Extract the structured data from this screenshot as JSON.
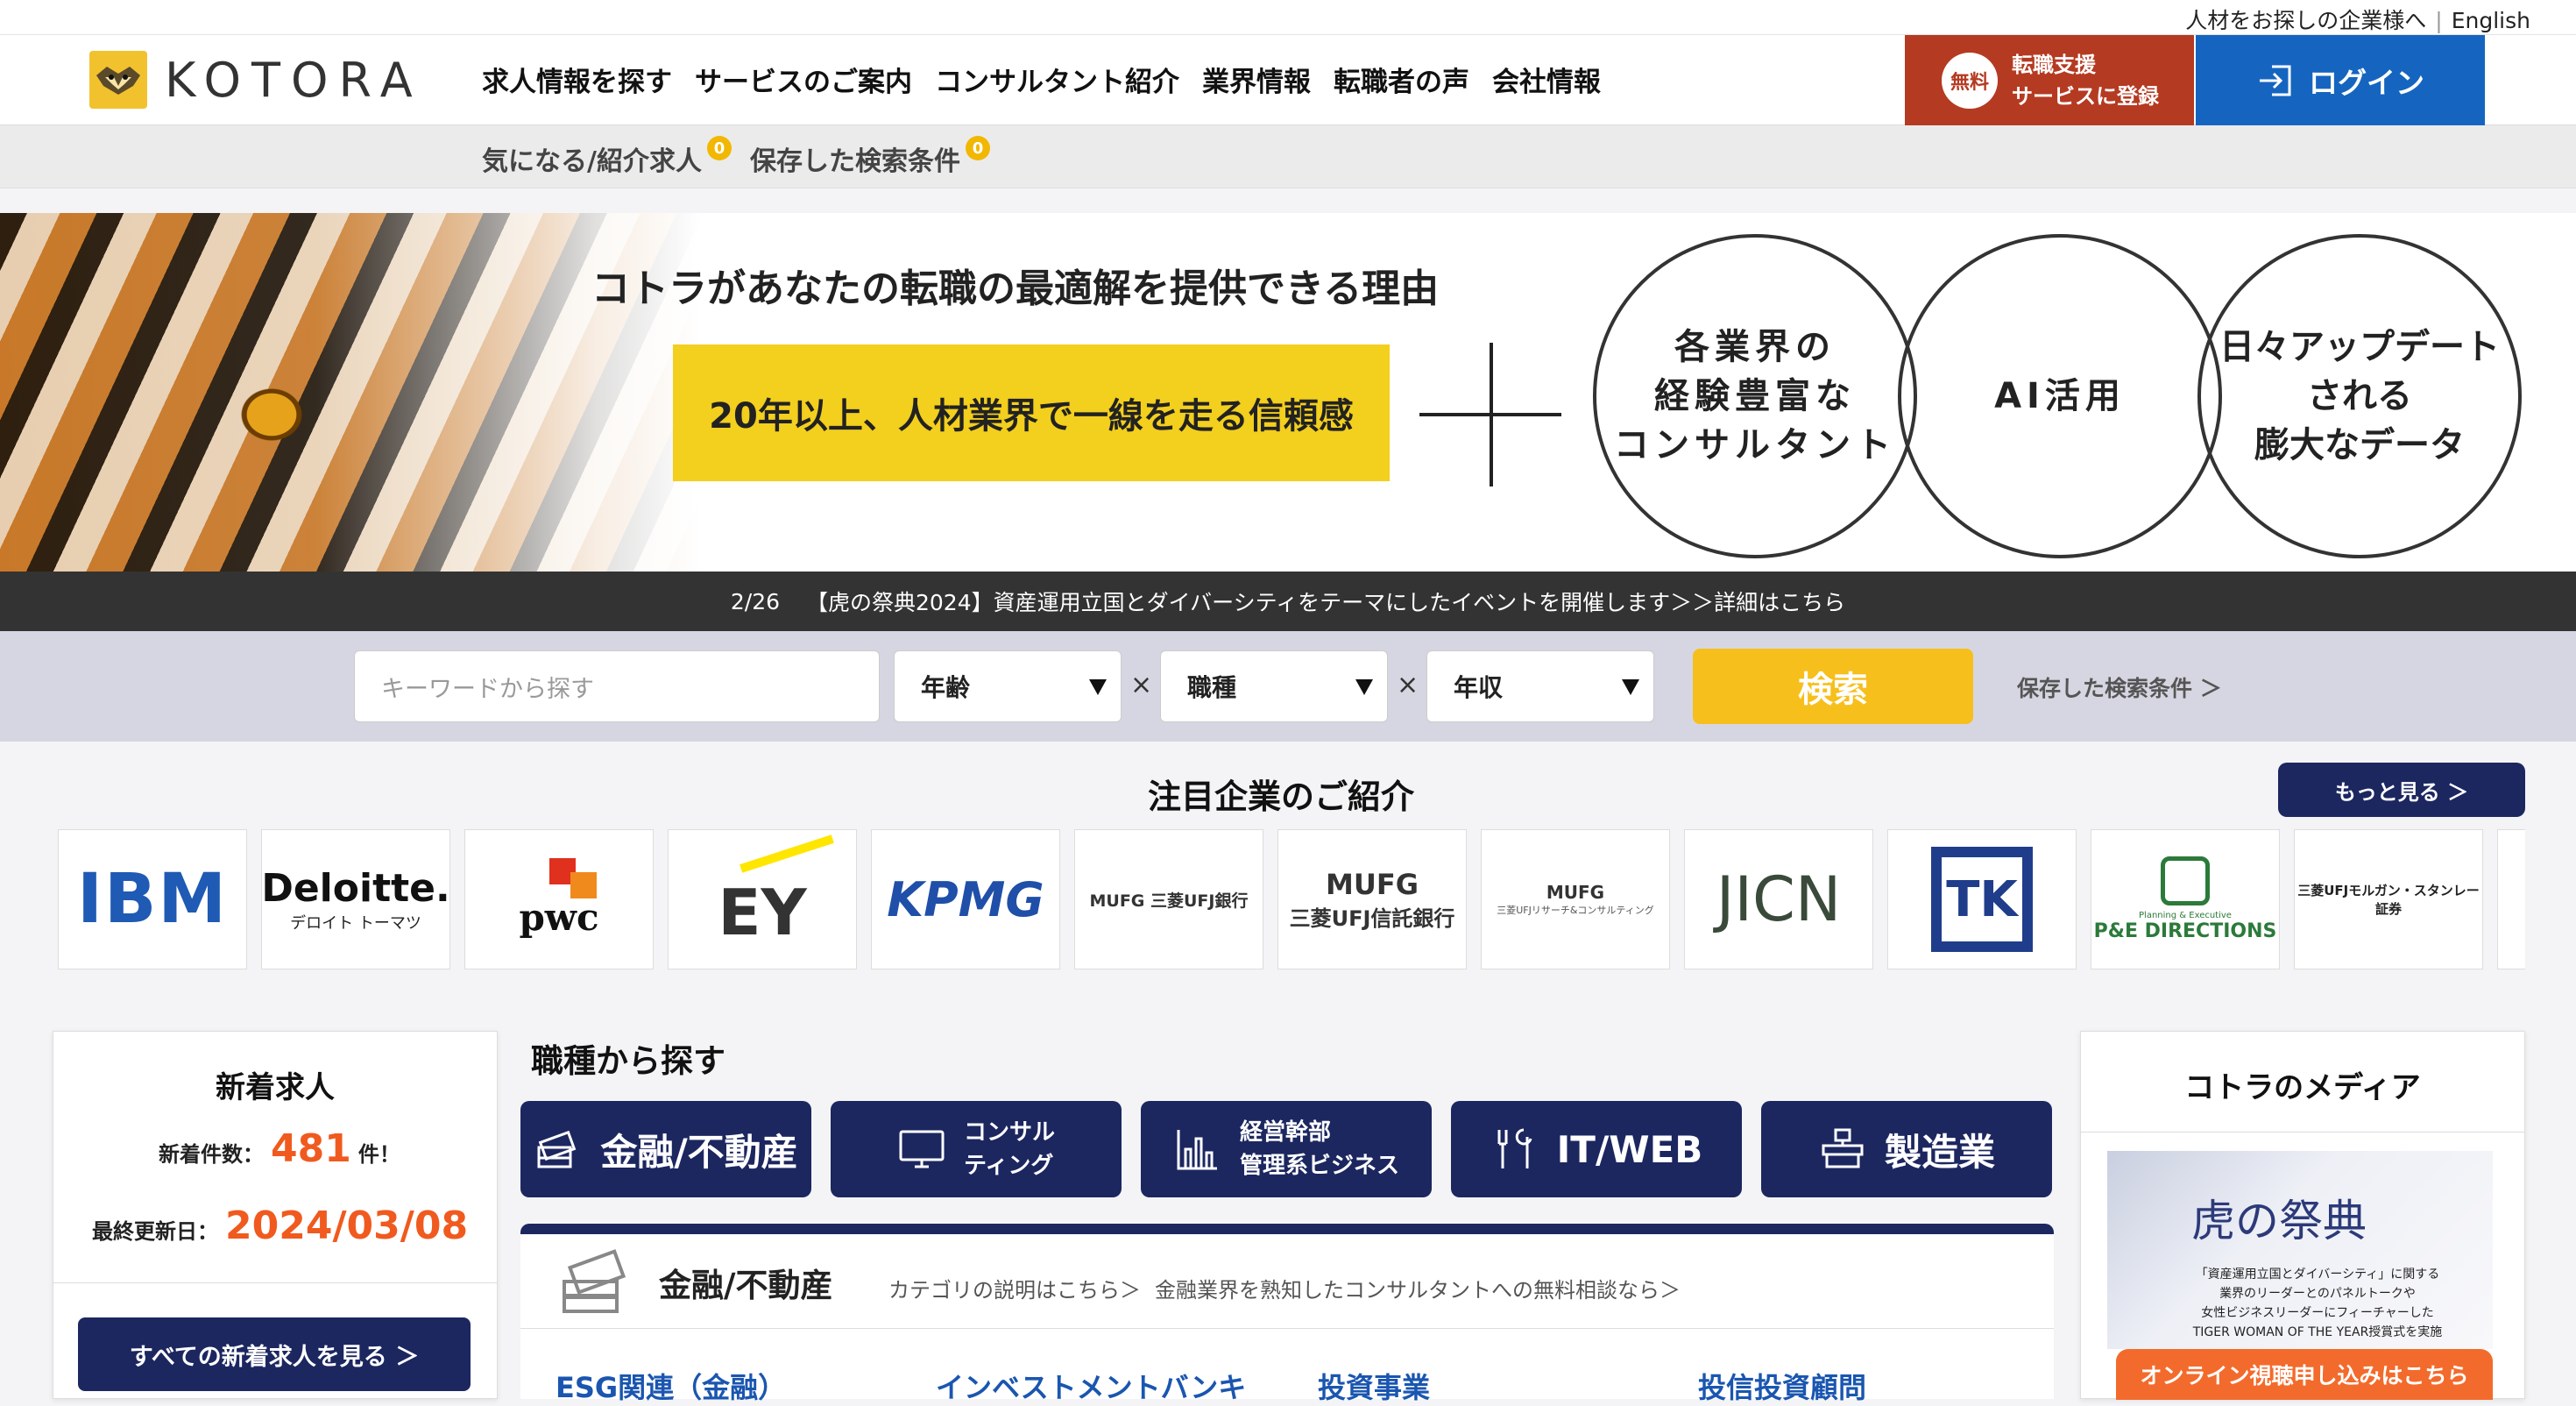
{
  "util": {
    "find_talent": "人材をお探しの企業様へ",
    "separator": "|",
    "english": "English"
  },
  "brand": {
    "name": "KOTORA"
  },
  "nav": [
    "求人情報を探す",
    "サービスのご案内",
    "コンサルタント紹介",
    "業界情報",
    "転職者の声",
    "会社情報"
  ],
  "register": {
    "badge": "無料",
    "line1": "転職支援",
    "line2": "サービスに登録",
    "color": "#b53a22"
  },
  "login": {
    "label": "ログイン",
    "color": "#1565c0"
  },
  "subbar": {
    "fav": "気になる/紹介求人",
    "fav_count": "0",
    "saved": "保存した検索条件",
    "saved_count": "0"
  },
  "hero": {
    "title": "コトラがあなたの転職の最適解を提供できる理由",
    "yellow": "20年以上、人材業界で一線を走る信頼感",
    "circles": [
      [
        "各業界の",
        "経験豊富な",
        "コンサルタント"
      ],
      [
        "AI活用"
      ],
      [
        "日々アップデート",
        "される",
        "膨大なデータ"
      ]
    ]
  },
  "news": {
    "date": "2/26",
    "text": "【虎の祭典2024】資産運用立国とダイバーシティをテーマにしたイベントを開催します＞＞詳細はこちら"
  },
  "search": {
    "keyword_placeholder": "キーワードから探す",
    "age": "年齢",
    "job": "職種",
    "salary": "年収",
    "times": "×",
    "button": "検索",
    "saved_link": "保存した検索条件 ＞",
    "accent": "#f6bf1b"
  },
  "featured": {
    "title": "注目企業のご紹介",
    "more": "もっと見る ＞",
    "logos": [
      {
        "main": "IBM",
        "sub": ""
      },
      {
        "main": "Deloitte.",
        "sub": "デロイト トーマツ"
      },
      {
        "main": "pwc",
        "sub": ""
      },
      {
        "main": "EY",
        "sub": ""
      },
      {
        "main": "KPMG",
        "sub": ""
      },
      {
        "main": "MUFG 三菱UFJ銀行",
        "sub": ""
      },
      {
        "main": "MUFG",
        "sub": "三菱UFJ信託銀行"
      },
      {
        "main": "MUFG",
        "sub": "三菱UFJリサーチ&コンサルティング"
      },
      {
        "main": "JICN",
        "sub": ""
      },
      {
        "main": "TK",
        "sub": ""
      },
      {
        "main": "P&E DIRECTIONS",
        "sub": "Planning & Executive"
      },
      {
        "main": "三菱UFJモルガン・スタンレー証券",
        "sub": ""
      }
    ]
  },
  "newjobs": {
    "title": "新着求人",
    "count_label": "新着件数：",
    "count": "481",
    "count_unit": "件！",
    "updated_label": "最終更新日：",
    "updated": "2024/03/08",
    "button": "すべての新着求人を見る ＞",
    "highlight": "#f05a1f"
  },
  "categories": {
    "title": "職種から探す",
    "buttons": [
      {
        "big": "金融/不動産"
      },
      {
        "line1": "コンサル",
        "line2": "ティング"
      },
      {
        "line1": "経営幹部",
        "line2": "管理系ビジネス"
      },
      {
        "big": "IT/WEB"
      },
      {
        "big": "製造業"
      }
    ],
    "panel": {
      "name": "金融/不動産",
      "desc_link": "カテゴリの説明はこちら＞",
      "consult_link": "金融業界を熟知したコンサルタントへの無料相談なら＞",
      "subs": [
        "ESG関連（金融）",
        "インベストメントバンキ",
        "投資事業",
        "投信投資顧問"
      ]
    },
    "navy": "#1c2760"
  },
  "media": {
    "title": "コトラのメディア",
    "banner_title": "虎の祭典",
    "banner_text": [
      "「資産運用立国とダイバーシティ」に関する",
      "業界のリーダーとのパネルトークや",
      "女性ビジネスリーダーにフィーチャーした",
      "TIGER WOMAN OF THE YEAR授賞式を実施"
    ],
    "button": "オンライン視聴申し込みはこちら"
  }
}
